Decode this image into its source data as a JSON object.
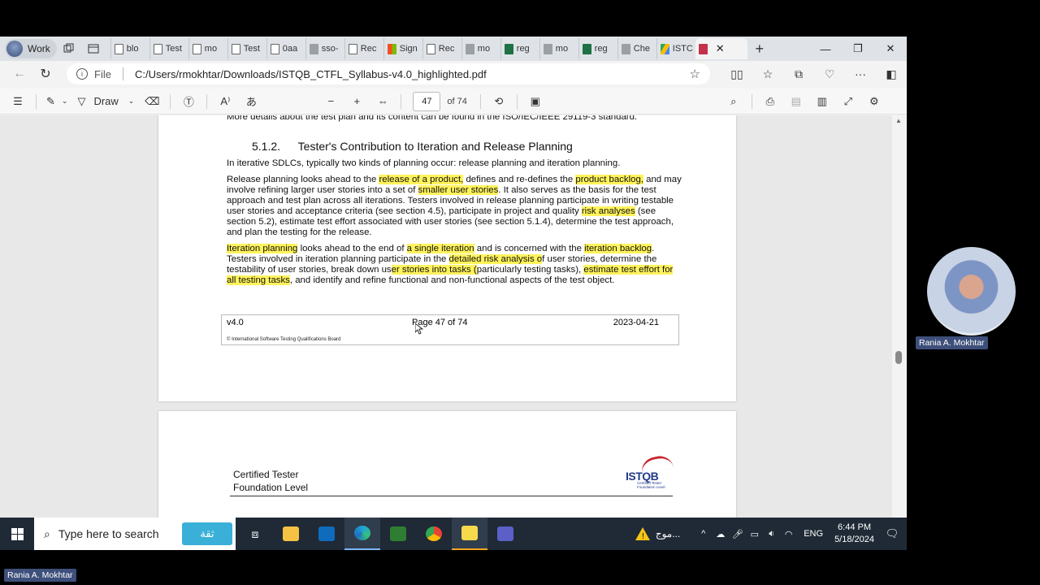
{
  "profile": {
    "label": "Work"
  },
  "tabs": [
    {
      "title": "blo",
      "icon": "page"
    },
    {
      "title": "Test",
      "icon": "page"
    },
    {
      "title": "mo",
      "icon": "page"
    },
    {
      "title": "Test",
      "icon": "page"
    },
    {
      "title": "0aa",
      "icon": "page"
    },
    {
      "title": "sso-",
      "icon": "gr"
    },
    {
      "title": "Rec",
      "icon": "page"
    },
    {
      "title": "Sign",
      "icon": "ms"
    },
    {
      "title": "Rec",
      "icon": "page"
    },
    {
      "title": "mo",
      "icon": "gr"
    },
    {
      "title": "reg",
      "icon": "xl"
    },
    {
      "title": "mo",
      "icon": "gr"
    },
    {
      "title": "reg",
      "icon": "xl"
    },
    {
      "title": "Che",
      "icon": "gr"
    },
    {
      "title": "ISTC",
      "icon": "gd"
    }
  ],
  "active_tab": {
    "icon": "pdf"
  },
  "address": {
    "scheme": "File",
    "url": "C:/Users/rmokhtar/Downloads/ISTQB_CTFL_Syllabus-v4.0_highlighted.pdf"
  },
  "pdf_toolbar": {
    "draw_label": "Draw",
    "page_number": "47",
    "page_total": "of 74"
  },
  "document": {
    "top_line": "More details about the test plan and its content can be found in the ISO/IEC/IEEE 29119-3 standard.",
    "section_number": "5.1.2.",
    "section_title": "Tester's Contribution to Iteration and Release Planning",
    "intro": "In iterative SDLCs, typically two kinds of planning occur: release planning and iteration planning.",
    "release": {
      "t1": "Release planning looks ahead to the ",
      "h1": "release of a product,",
      "t2": " defines and re-defines the ",
      "h2": "product backlog,",
      "t3": " and may involve refining larger user stories into a set of ",
      "h3": "smaller user stories",
      "t4": ". It also serves as the basis for the test approach and test plan across all iterations. Testers involved in release planning participate in writing testable user stories and acceptance criteria (see section 4.5), participate in project and quality ",
      "h4": "risk analyses",
      "t5": " (see section 5.2), estimate test effort associated with user stories (see section 5.1.4), determine the test approach, and plan the testing for the release."
    },
    "iteration": {
      "h1": "Iteration planning",
      "t1": " looks ahead to the end of ",
      "h2": "a single iteration",
      "t2": " and is concerned with the ",
      "h3": "iteration backlog",
      "t3": ". Testers involved in iteration planning participate in the ",
      "h4": "detailed risk analysis o",
      "t4": "f user stories, determine the testability of user stories, break down us",
      "h5": "er stories into tasks (",
      "t5": "particularly testing tasks), ",
      "h6": "estimate test effort for all testing tasks",
      "t6": ", and identify and refine functional and non-functional aspects of the test object."
    },
    "footer": {
      "version": "v4.0",
      "page": "Page 47 of 74",
      "date": "2023-04-21",
      "copyright": "© International Software Testing Qualifications Board"
    },
    "next_page_header": {
      "line1": "Certified Tester",
      "line2": "Foundation Level",
      "logo_word": "ISTQB",
      "logo_sub1": "Certified Tester",
      "logo_sub2": "Foundation Level"
    }
  },
  "participant": {
    "name": "Rania A. Mokhtar"
  },
  "self_label": {
    "name": "Rania A. Mokhtar"
  },
  "taskbar": {
    "search_placeholder": "Type here to search",
    "search_badge": "ثقة",
    "tray_text": "موج...",
    "lang": "ENG",
    "time": "6:44 PM",
    "date": "5/18/2024"
  },
  "colors": {
    "highlight": "#fff35c",
    "taskbar": "#1f2a36",
    "name_tag": "#3d4f7a"
  }
}
